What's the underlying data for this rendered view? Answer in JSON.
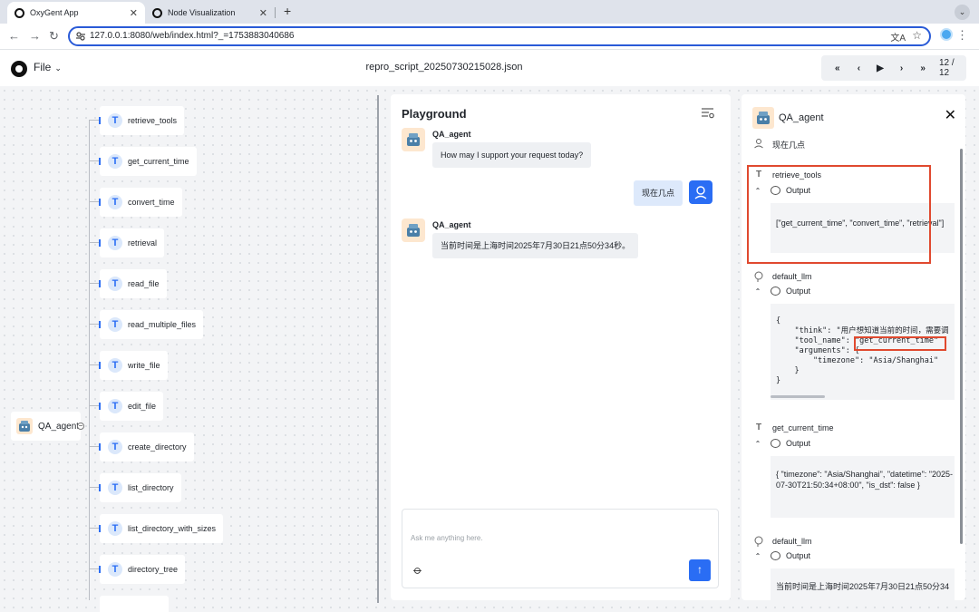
{
  "browser": {
    "tabs": [
      {
        "title": "OxyGent App",
        "active": true
      },
      {
        "title": "Node Visualization",
        "active": false
      }
    ],
    "new_tab": "+",
    "url": "127.0.0.1:8080/web/index.html?_=1753883040686"
  },
  "header": {
    "file_menu": "File",
    "document_title": "repro_script_20250730215028.json",
    "playback": {
      "first": "«",
      "prev": "‹",
      "play": "▶",
      "next": "›",
      "last": "»",
      "counter": "12 / 12"
    }
  },
  "tree": {
    "root": {
      "label": "QA_agent",
      "collapse": "−"
    },
    "children": [
      {
        "label": "retrieve_tools"
      },
      {
        "label": "get_current_time"
      },
      {
        "label": "convert_time"
      },
      {
        "label": "retrieval"
      },
      {
        "label": "read_file"
      },
      {
        "label": "read_multiple_files"
      },
      {
        "label": "write_file"
      },
      {
        "label": "edit_file"
      },
      {
        "label": "create_directory"
      },
      {
        "label": "list_directory"
      },
      {
        "label": "list_directory_with_sizes"
      },
      {
        "label": "directory_tree"
      }
    ]
  },
  "playground": {
    "title": "Playground",
    "messages": [
      {
        "sender": "QA_agent",
        "text": "How may I support your request today?"
      },
      {
        "sender": "user",
        "text": "现在几点"
      },
      {
        "sender": "QA_agent",
        "text": "当前时间是上海时间2025年7月30日21点50分34秒。"
      }
    ],
    "input_placeholder": "Ask me anything here."
  },
  "detail": {
    "title": "QA_agent",
    "close": "✕",
    "user_query": "现在几点",
    "steps": [
      {
        "name": "retrieve_tools",
        "output_label": "Output",
        "output": "[\"get_current_time\", \"convert_time\", \"retrieval\"]"
      },
      {
        "name": "default_llm",
        "output_label": "Output",
        "output_lines": [
          "{",
          "    \"think\": \"用户想知道当前的时间，需要调",
          "    \"tool_name\": \"get_current_time\"",
          "    \"arguments\": {",
          "        \"timezone\": \"Asia/Shanghai\"",
          "    }",
          "}"
        ]
      },
      {
        "name": "get_current_time",
        "output_label": "Output",
        "output": "{ \"timezone\": \"Asia/Shanghai\", \"datetime\": \"2025-07-30T21:50:34+08:00\", \"is_dst\": false }"
      },
      {
        "name": "default_llm",
        "output_label": "Output",
        "output": "当前时间是上海时间2025年7月30日21点50分34"
      }
    ]
  },
  "colors": {
    "accent": "#2a6df4",
    "highlight_box": "#e0492f",
    "canvas": "#f3f4f6"
  }
}
